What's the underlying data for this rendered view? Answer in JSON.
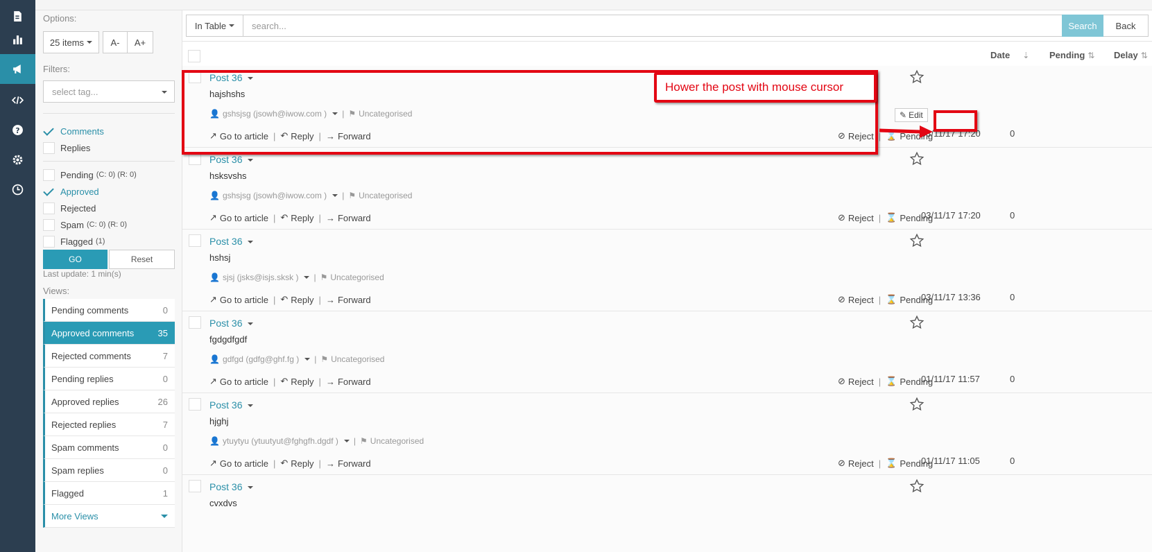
{
  "sidebar": {
    "options_label": "Options:",
    "items_per_page": "25 items",
    "font_smaller": "A-",
    "font_larger": "A+",
    "filters_label": "Filters:",
    "tag_placeholder": "select tag...",
    "type_filters": [
      {
        "label": "Comments",
        "checked": true
      },
      {
        "label": "Replies",
        "checked": false
      }
    ],
    "status_filters": [
      {
        "label": "Pending",
        "count": "(C: 0) (R: 0)",
        "checked": false
      },
      {
        "label": "Approved",
        "count": "",
        "checked": true
      },
      {
        "label": "Rejected",
        "count": "",
        "checked": false
      },
      {
        "label": "Spam",
        "count": "(C: 0) (R: 0)",
        "checked": false
      },
      {
        "label": "Flagged",
        "count": "(1)",
        "checked": false
      }
    ],
    "go_label": "GO",
    "reset_label": "Reset",
    "last_update": "Last update: 1 min(s)",
    "views_label": "Views:",
    "views": [
      {
        "label": "Pending comments",
        "count": "0",
        "active": false
      },
      {
        "label": "Approved comments",
        "count": "35",
        "active": true
      },
      {
        "label": "Rejected comments",
        "count": "7",
        "active": false
      },
      {
        "label": "Pending replies",
        "count": "0",
        "active": false
      },
      {
        "label": "Approved replies",
        "count": "26",
        "active": false
      },
      {
        "label": "Rejected replies",
        "count": "7",
        "active": false
      },
      {
        "label": "Spam comments",
        "count": "0",
        "active": false
      },
      {
        "label": "Spam replies",
        "count": "0",
        "active": false
      },
      {
        "label": "Flagged",
        "count": "1",
        "active": false
      }
    ],
    "more_views": "More Views"
  },
  "search": {
    "scope": "In Table",
    "placeholder": "search...",
    "search_label": "Search",
    "back_label": "Back"
  },
  "table": {
    "columns": {
      "date": "Date",
      "pending": "Pending",
      "delay": "Delay"
    },
    "rows": [
      {
        "title": "Post 36",
        "body": "hajshshs",
        "author": "gshsjsg (jsowh@iwow.com )",
        "category": "Uncategorised",
        "date": "03/11/17 17:20",
        "delay": "0",
        "show_edit": true
      },
      {
        "title": "Post 36",
        "body": "hsksvshs",
        "author": "gshsjsg (jsowh@iwow.com )",
        "category": "Uncategorised",
        "date": "03/11/17 17:20",
        "delay": "0",
        "show_edit": false
      },
      {
        "title": "Post 36",
        "body": "hshsj",
        "author": "sjsj (jsks@isjs.sksk )",
        "category": "Uncategorised",
        "date": "03/11/17 13:36",
        "delay": "0",
        "show_edit": false
      },
      {
        "title": "Post 36",
        "body": "fgdgdfgdf",
        "author": "gdfgd (gdfg@ghf.fg )",
        "category": "Uncategorised",
        "date": "01/11/17 11:57",
        "delay": "0",
        "show_edit": false
      },
      {
        "title": "Post 36",
        "body": "hjghj",
        "author": "ytuytyu (ytuutyut@fghgfh.dgdf )",
        "category": "Uncategorised",
        "date": "01/11/17 11:05",
        "delay": "0",
        "show_edit": false
      },
      {
        "title": "Post 36",
        "body": "cvxdvs",
        "author": "",
        "category": "",
        "date": "",
        "delay": "",
        "show_edit": false
      }
    ],
    "actions": {
      "go_to_article": "Go to article",
      "reply": "Reply",
      "forward": "Forward",
      "reject": "Reject",
      "pending": "Pending",
      "edit": "Edit"
    }
  },
  "annotation": {
    "callout": "Hower the post with mouse cursor"
  },
  "colors": {
    "accent": "#2a9bb5",
    "rail": "#2c3e50",
    "annotation": "#e30613"
  }
}
